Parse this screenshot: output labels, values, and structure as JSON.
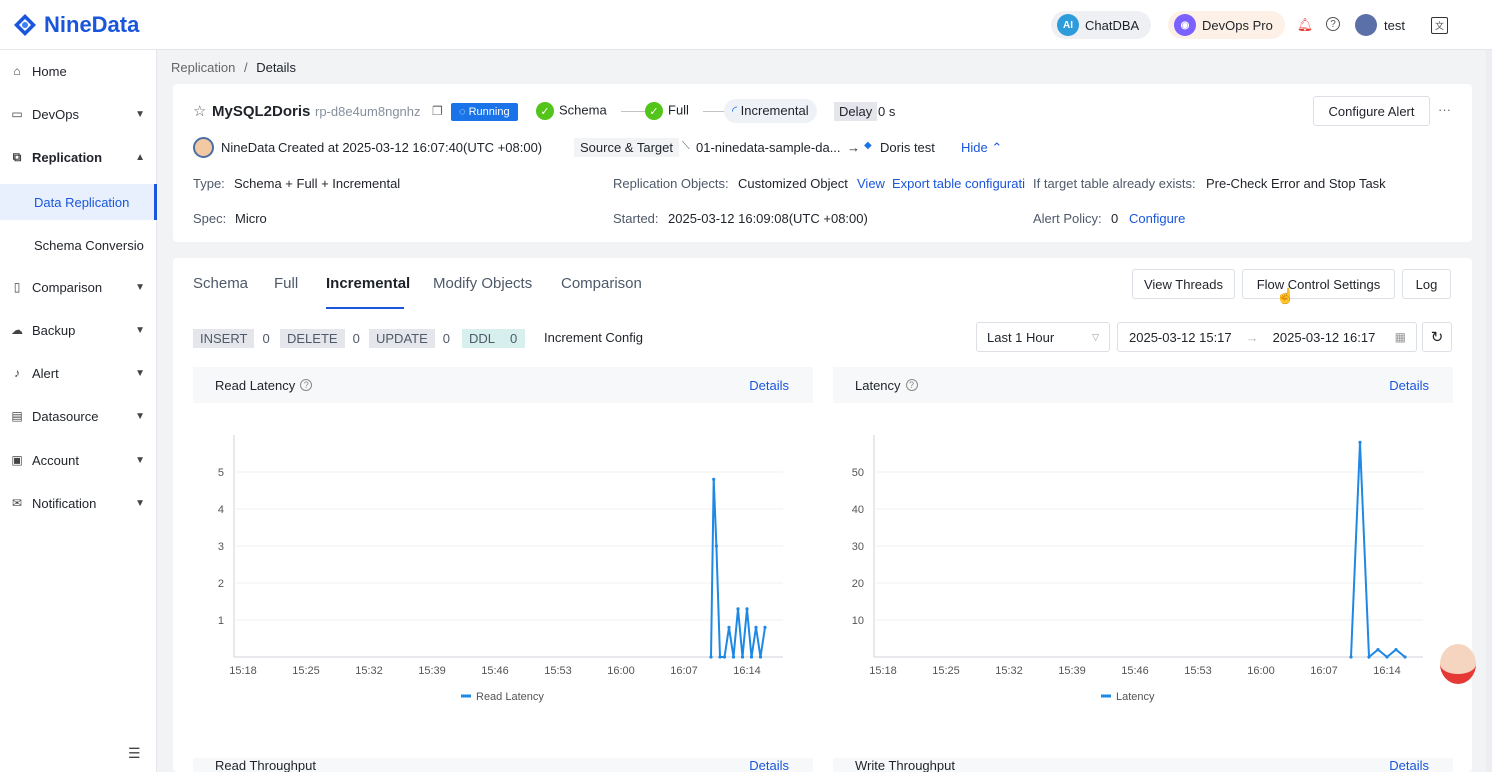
{
  "brand": {
    "name": "NineData"
  },
  "topbar": {
    "chatdba": "ChatDBA",
    "devops_pro": "DevOps Pro",
    "user": "test"
  },
  "sidebar": {
    "items": [
      {
        "label": "Home",
        "icon": "home-icon"
      },
      {
        "label": "DevOps",
        "icon": "devops-icon"
      },
      {
        "label": "Replication",
        "icon": "replication-icon"
      },
      {
        "label": "Comparison",
        "icon": "comparison-icon"
      },
      {
        "label": "Backup",
        "icon": "backup-icon"
      },
      {
        "label": "Alert",
        "icon": "alert-icon"
      },
      {
        "label": "Datasource",
        "icon": "datasource-icon"
      },
      {
        "label": "Account",
        "icon": "account-icon"
      },
      {
        "label": "Notification",
        "icon": "notification-icon"
      }
    ],
    "sub_items": [
      {
        "label": "Data Replication"
      },
      {
        "label": "Schema Conversio"
      }
    ]
  },
  "breadcrumb": {
    "parent": "Replication",
    "sep": "/",
    "current": "Details"
  },
  "task": {
    "name": "MySQL2Doris",
    "id": "rp-d8e4um8ngnhz",
    "status": "Running",
    "stages": [
      "Schema",
      "Full",
      "Incremental"
    ],
    "delay_label": "Delay",
    "delay_value": "0 s",
    "configure_alert": "Configure Alert",
    "more": "···",
    "creator": "NineData",
    "created": "Created at 2025-03-12 16:07:40(UTC +08:00)",
    "source_target_label": "Source & Target",
    "source": "01-ninedata-sample-da...",
    "target": "Doris test",
    "hide": "Hide",
    "type_label": "Type:",
    "type_value": "Schema + Full + Incremental",
    "spec_label": "Spec:",
    "spec_value": "Micro",
    "objects_label": "Replication Objects:",
    "objects_value": "Customized Object",
    "view": "View",
    "export": "Export table configurati",
    "started_label": "Started:",
    "started_value": "2025-03-12 16:09:08(UTC +08:00)",
    "if_target_label": "If target table already exists:",
    "if_target_value": "Pre-Check Error and Stop Task",
    "alert_policy_label": "Alert Policy:",
    "alert_policy_value": "0",
    "configure": "Configure"
  },
  "tabs": [
    "Schema",
    "Full",
    "Incremental",
    "Modify Objects",
    "Comparison"
  ],
  "actions": {
    "view_threads": "View Threads",
    "flow_control": "Flow Control Settings",
    "log": "Log"
  },
  "counters": [
    {
      "label": "INSERT",
      "value": "0"
    },
    {
      "label": "DELETE",
      "value": "0"
    },
    {
      "label": "UPDATE",
      "value": "0"
    },
    {
      "label": "DDL",
      "value": "0"
    }
  ],
  "increment_config": "Increment Config",
  "time_filter": {
    "range": "Last 1 Hour",
    "start": "2025-03-12 15:17",
    "arrow": "→",
    "end": "2025-03-12 16:17"
  },
  "details_link": "Details",
  "bottom_titles": [
    "Read Throughput",
    "Write Throughput"
  ],
  "chart_data": [
    {
      "type": "line",
      "title": "Read Latency",
      "legend": "Read Latency",
      "x_ticks": [
        "15:18",
        "15:25",
        "15:32",
        "15:39",
        "15:46",
        "15:53",
        "16:00",
        "16:07",
        "16:14"
      ],
      "y_ticks": [
        1,
        2,
        3,
        4,
        5
      ],
      "ylim": [
        0,
        6
      ],
      "x": [
        "16:10",
        "16:10.3",
        "16:10.6",
        "16:11",
        "16:11.5",
        "16:12",
        "16:12.5",
        "16:13",
        "16:13.5",
        "16:14",
        "16:14.5",
        "16:15",
        "16:15.5",
        "16:16"
      ],
      "values": [
        0,
        4.8,
        3,
        0,
        0,
        0.8,
        0,
        1.3,
        0,
        1.3,
        0,
        0.8,
        0,
        0.8
      ],
      "series": [
        {
          "name": "Read Latency",
          "color": "#1e88e5"
        }
      ]
    },
    {
      "type": "line",
      "title": "Latency",
      "legend": "Latency",
      "x_ticks": [
        "15:18",
        "15:25",
        "15:32",
        "15:39",
        "15:46",
        "15:53",
        "16:00",
        "16:07",
        "16:14"
      ],
      "y_ticks": [
        10,
        20,
        30,
        40,
        50
      ],
      "ylim": [
        0,
        60
      ],
      "x": [
        "16:10",
        "16:11",
        "16:12",
        "16:13",
        "16:14",
        "16:15",
        "16:16"
      ],
      "values": [
        0,
        58,
        0,
        2,
        0,
        2,
        0
      ],
      "series": [
        {
          "name": "Latency",
          "color": "#1e88e5"
        }
      ]
    }
  ]
}
